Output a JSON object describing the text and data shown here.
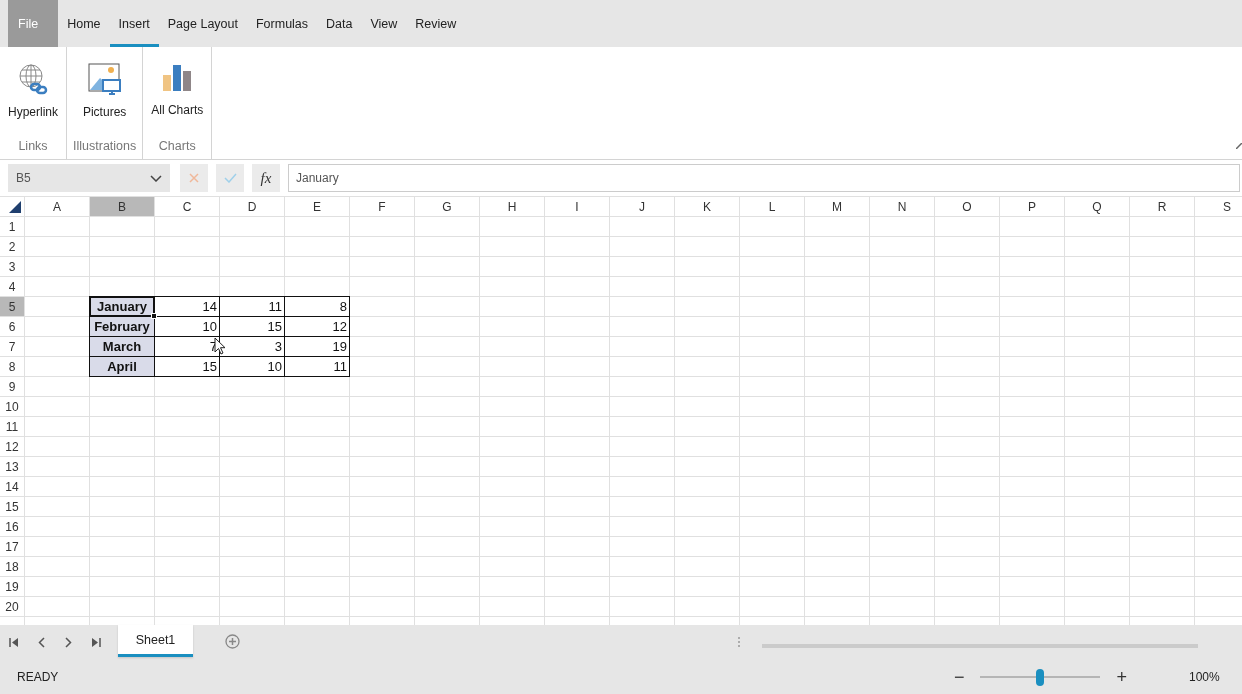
{
  "ribbon_tabs": [
    {
      "label": "File",
      "kind": "file",
      "selected": false
    },
    {
      "label": "Home",
      "kind": "tab",
      "selected": false
    },
    {
      "label": "Insert",
      "kind": "tab",
      "selected": true
    },
    {
      "label": "Page Layout",
      "kind": "tab",
      "selected": false
    },
    {
      "label": "Formulas",
      "kind": "tab",
      "selected": false
    },
    {
      "label": "Data",
      "kind": "tab",
      "selected": false
    },
    {
      "label": "View",
      "kind": "tab",
      "selected": false
    },
    {
      "label": "Review",
      "kind": "tab",
      "selected": false
    }
  ],
  "ribbon_groups": [
    {
      "name": "Links",
      "kind": "hyperlink",
      "button": "Hyperlink"
    },
    {
      "name": "Illustrations",
      "kind": "pictures",
      "button": "Pictures"
    },
    {
      "name": "Charts",
      "kind": "charts",
      "button": "All Charts"
    }
  ],
  "formula_bar": {
    "name_box": "B5",
    "function_button": "fx",
    "value": "January"
  },
  "columns": [
    {
      "label": "A",
      "selected": false
    },
    {
      "label": "B",
      "selected": true
    },
    {
      "label": "C",
      "selected": false
    },
    {
      "label": "D",
      "selected": false
    },
    {
      "label": "E",
      "selected": false
    },
    {
      "label": "F",
      "selected": false
    },
    {
      "label": "G",
      "selected": false
    },
    {
      "label": "H",
      "selected": false
    },
    {
      "label": "I",
      "selected": false
    },
    {
      "label": "J",
      "selected": false
    },
    {
      "label": "K",
      "selected": false
    },
    {
      "label": "L",
      "selected": false
    },
    {
      "label": "M",
      "selected": false
    },
    {
      "label": "N",
      "selected": false
    },
    {
      "label": "O",
      "selected": false
    },
    {
      "label": "P",
      "selected": false
    },
    {
      "label": "Q",
      "selected": false
    },
    {
      "label": "R",
      "selected": false
    },
    {
      "label": "S",
      "selected": false
    }
  ],
  "rows": [
    {
      "label": "1",
      "selected": false
    },
    {
      "label": "2",
      "selected": false
    },
    {
      "label": "3",
      "selected": false
    },
    {
      "label": "4",
      "selected": false
    },
    {
      "label": "5",
      "selected": true
    },
    {
      "label": "6",
      "selected": false
    },
    {
      "label": "7",
      "selected": false
    },
    {
      "label": "8",
      "selected": false
    },
    {
      "label": "9",
      "selected": false
    },
    {
      "label": "10",
      "selected": false
    },
    {
      "label": "11",
      "selected": false
    },
    {
      "label": "12",
      "selected": false
    },
    {
      "label": "13",
      "selected": false
    },
    {
      "label": "14",
      "selected": false
    },
    {
      "label": "15",
      "selected": false
    },
    {
      "label": "16",
      "selected": false
    },
    {
      "label": "17",
      "selected": false
    },
    {
      "label": "18",
      "selected": false
    },
    {
      "label": "19",
      "selected": false
    },
    {
      "label": "20",
      "selected": false
    }
  ],
  "data_block": [
    {
      "label": "January",
      "selected": true,
      "values": [
        "14",
        "11",
        "8"
      ]
    },
    {
      "label": "February",
      "selected": false,
      "values": [
        "10",
        "15",
        "12"
      ]
    },
    {
      "label": "March",
      "selected": false,
      "values": [
        "7",
        "3",
        "19"
      ]
    },
    {
      "label": "April",
      "selected": false,
      "values": [
        "15",
        "10",
        "11"
      ]
    }
  ],
  "sheet_tabs": [
    {
      "label": "Sheet1",
      "selected": true
    }
  ],
  "status_bar": {
    "status": "READY",
    "zoom_minus": "−",
    "zoom_plus": "+",
    "zoom": "100%",
    "zoom_slider": {
      "level": 0.5
    }
  }
}
